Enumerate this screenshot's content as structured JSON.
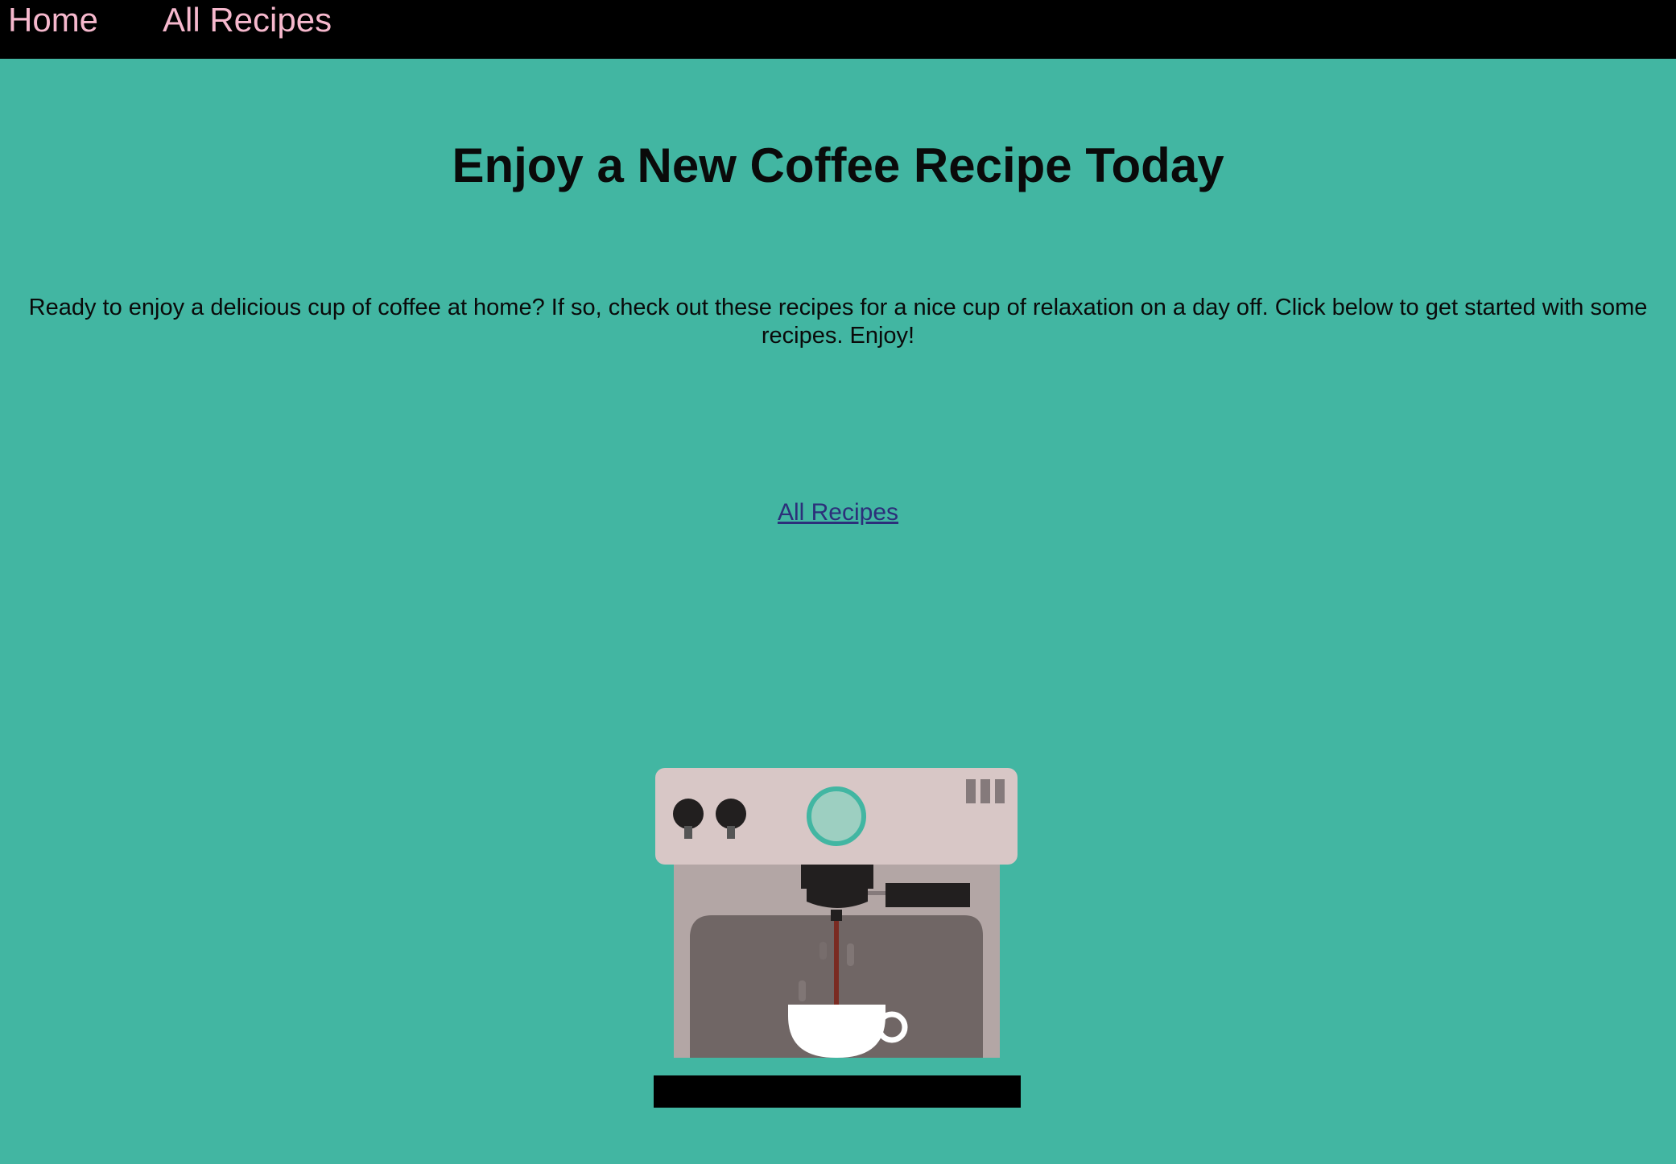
{
  "nav": {
    "home_label": "Home",
    "recipes_label": "All Recipes"
  },
  "main": {
    "title": "Enjoy a New Coffee Recipe Today",
    "intro": "Ready to enjoy a delicious cup of coffee at home? If so, check out these recipes for a nice cup of relaxation on a day off. Click below to get started with some recipes. Enjoy!",
    "cta_label": "All Recipes"
  },
  "illustration": {
    "icon": "espresso-machine-icon"
  },
  "colors": {
    "background": "#42b6a2",
    "navbar": "#000000",
    "nav_link": "#f6b8cd",
    "link": "#2c2f7a"
  }
}
